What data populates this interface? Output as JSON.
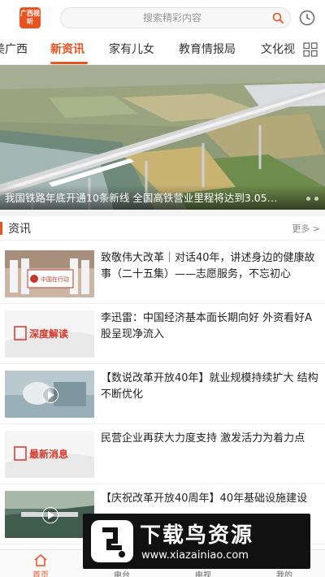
{
  "header": {
    "logo_text": "广西视听",
    "search_placeholder": "搜索精彩内容"
  },
  "tabs": [
    {
      "label": "美广西"
    },
    {
      "label": "新资讯"
    },
    {
      "label": "家有儿女"
    },
    {
      "label": "教育情报局"
    },
    {
      "label": "文化视"
    }
  ],
  "banner": {
    "caption": "我国铁路年底开通10条新线 全国高铁营业里程将达到3.05…"
  },
  "section": {
    "title": "资讯",
    "more": "更多 >"
  },
  "news": [
    {
      "title": "致敬伟大改革｜对话40年，讲述身边的健康故事（二十五集）——志愿服务，不忘初心",
      "thumb_text": "中国在行动"
    },
    {
      "title": "李迅雷：中国经济基本面长期向好 外资看好A股呈现净流入",
      "thumb_text": "深度解读"
    },
    {
      "title": "【数说改革开放40年】就业规模持续扩大 结构不断优化",
      "thumb_text": ""
    },
    {
      "title": "民营企业再获大力度支持 激发活力为着力点",
      "thumb_text": "最新消息"
    },
    {
      "title": "【庆祝改革开放40周年】40年基础设施建设",
      "thumb_text": ""
    }
  ],
  "bottom_nav": [
    {
      "label": "首页"
    },
    {
      "label": "电台"
    },
    {
      "label": "电视"
    },
    {
      "label": "我的"
    }
  ],
  "watermark": {
    "title": "下载鸟资源",
    "url": "www.xiazainiao.com"
  },
  "colors": {
    "accent": "#e8531f"
  }
}
